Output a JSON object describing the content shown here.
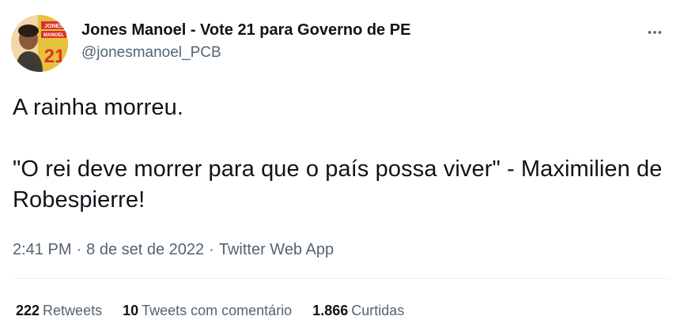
{
  "author": {
    "display_name": "Jones Manoel - Vote 21 para Governo de PE",
    "handle": "@jonesmanoel_PCB",
    "avatar_text_top": "JONES",
    "avatar_text_mid": "MANOEL",
    "avatar_number": "21"
  },
  "menu": {
    "icon": "more-horizontal-icon"
  },
  "tweet": {
    "text": "A rainha morreu.\n\n\"O rei deve morrer para que o país possa viver\" - Maximilien de Robespierre!"
  },
  "meta": {
    "time": "2:41 PM",
    "separator": "·",
    "date": "8 de set de 2022",
    "source": "Twitter Web App"
  },
  "stats": {
    "retweets": {
      "count": "222",
      "label": "Retweets"
    },
    "quotes": {
      "count": "10",
      "label": "Tweets com comentário"
    },
    "likes": {
      "count": "1.866",
      "label": "Curtidas"
    }
  },
  "colors": {
    "text_primary": "#0f1419",
    "text_secondary": "#536471",
    "divider": "#eff3f4"
  }
}
